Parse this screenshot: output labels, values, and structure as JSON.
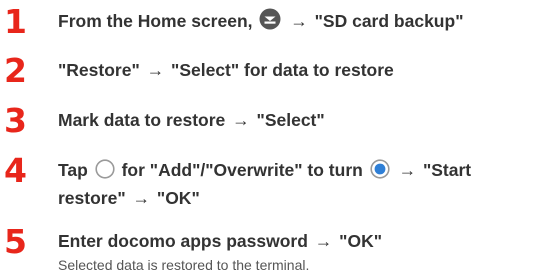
{
  "steps": [
    {
      "number": "1",
      "text_a": "From the Home screen,",
      "arrow": "→",
      "text_b": "\"SD card backup\"",
      "icon": "apps-menu-icon"
    },
    {
      "number": "2",
      "text_a": "\"Restore\"",
      "arrow": "→",
      "text_b": "\"Select\" for data to restore"
    },
    {
      "number": "3",
      "text_a": "Mark data to restore",
      "arrow": "→",
      "text_b": "\"Select\""
    },
    {
      "number": "4",
      "text_a": "Tap",
      "text_b": "for \"Add\"/\"Overwrite\" to turn",
      "arrow": "→",
      "text_c": "\"Start",
      "text_d": "restore\"",
      "arrow2": "→",
      "text_e": "\"OK\"",
      "icon_off": "radio-off-icon",
      "icon_on": "radio-on-icon"
    },
    {
      "number": "5",
      "text_a": "Enter docomo apps password",
      "arrow": "→",
      "text_b": "\"OK\"",
      "note": "Selected data is restored to the terminal."
    }
  ],
  "colors": {
    "step_number": "#e8261b",
    "text": "#333333",
    "radio_on": "#2f7fd6"
  }
}
